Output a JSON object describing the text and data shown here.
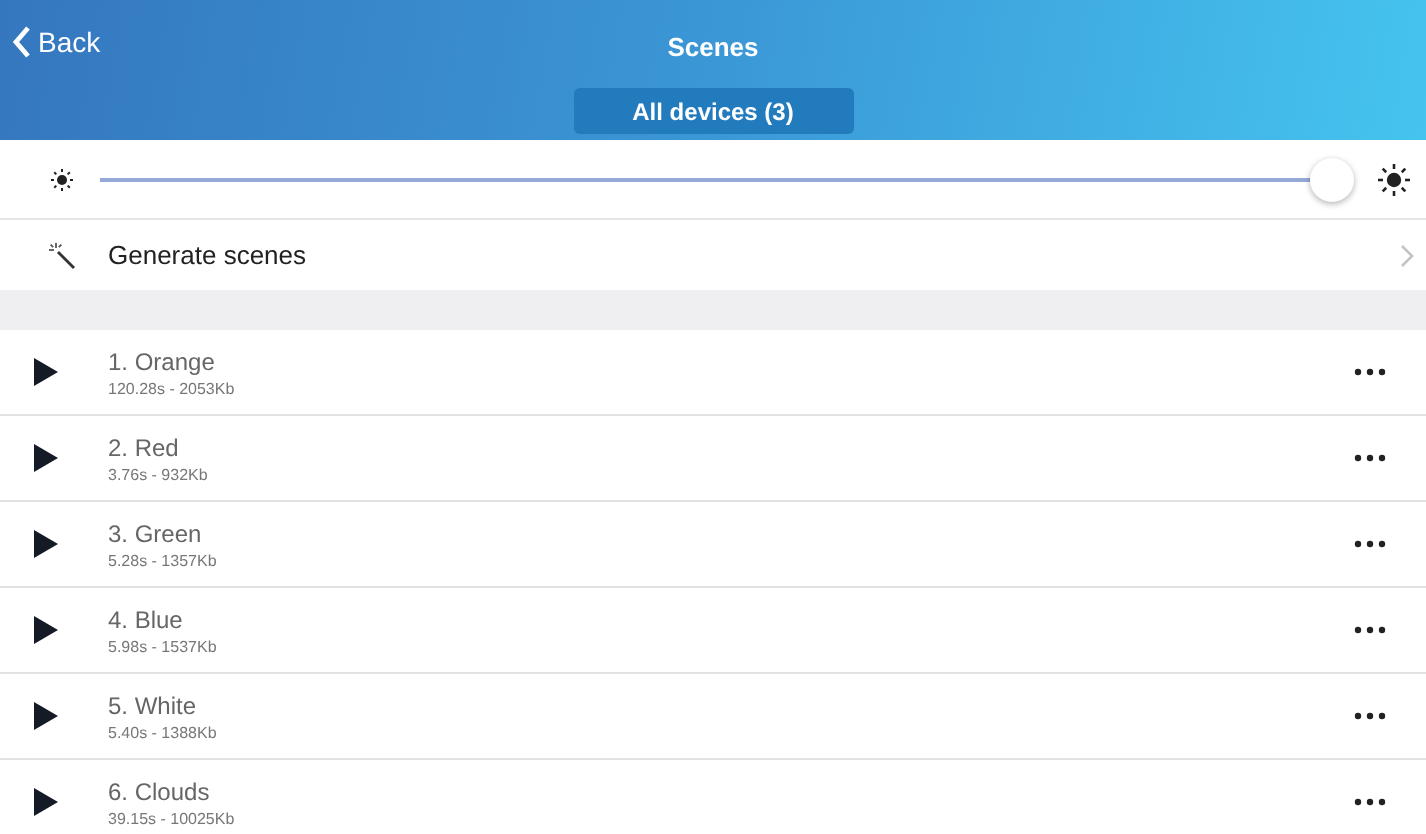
{
  "header": {
    "back": "Back",
    "title": "Scenes",
    "device_filter": "All devices (3)"
  },
  "brightness": {
    "level": 0.985
  },
  "generate": {
    "label": "Generate scenes"
  },
  "scenes": [
    {
      "name": "1. Orange",
      "info": "120.28s - 2053Kb"
    },
    {
      "name": "2. Red",
      "info": "3.76s - 932Kb"
    },
    {
      "name": "3. Green",
      "info": "5.28s - 1357Kb"
    },
    {
      "name": "4. Blue",
      "info": "5.98s - 1537Kb"
    },
    {
      "name": "5. White",
      "info": "5.40s - 1388Kb"
    },
    {
      "name": "6. Clouds",
      "info": "39.15s - 10025Kb"
    }
  ]
}
